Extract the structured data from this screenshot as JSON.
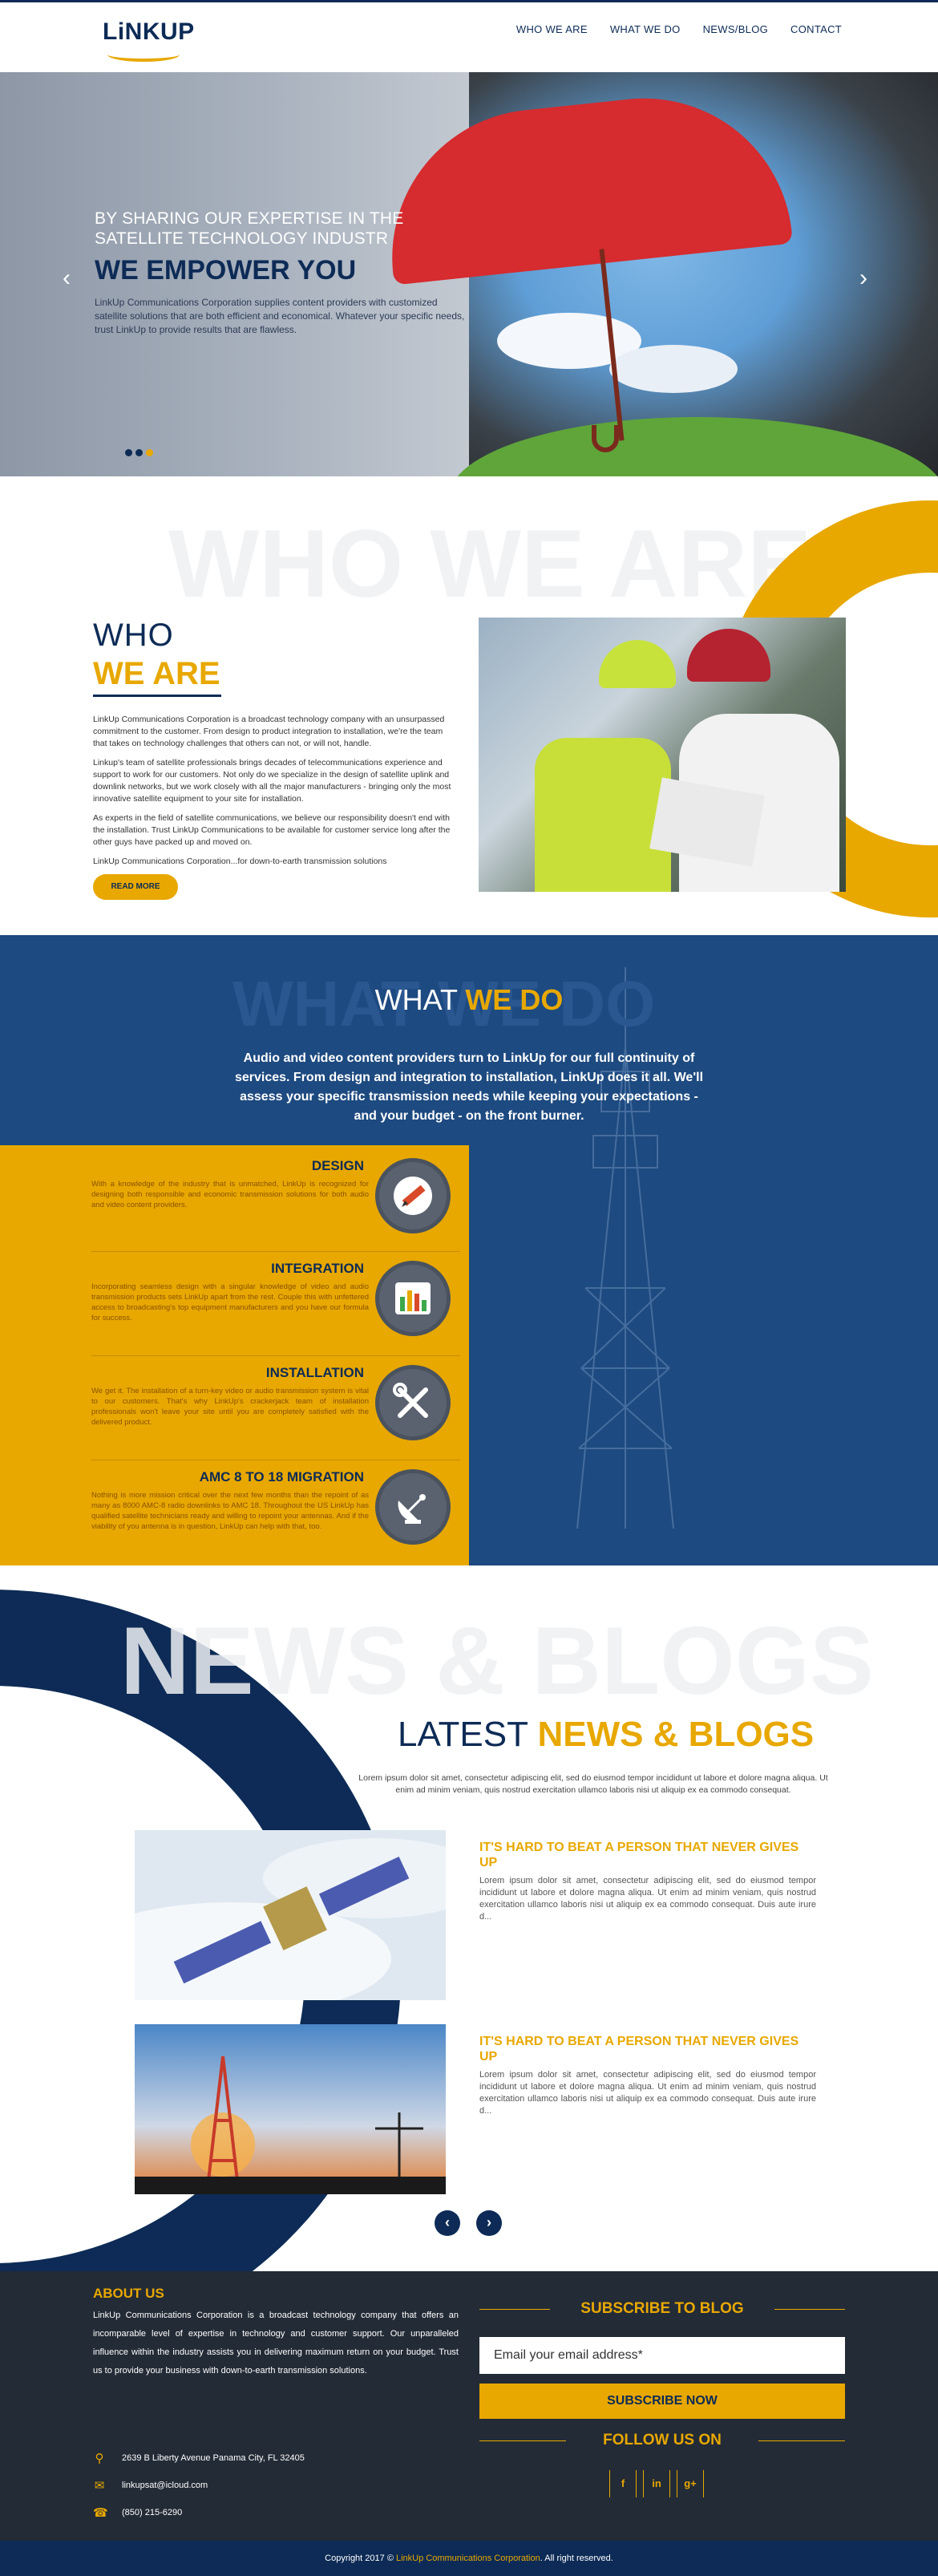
{
  "header": {
    "logo_text": "LiNKUP",
    "nav": [
      "WHO WE ARE",
      "WHAT WE DO",
      "NEWS/BLOG",
      "CONTACT"
    ]
  },
  "hero": {
    "kicker": "BY SHARING OUR EXPERTISE IN THE SATELLITE TECHNOLOGY INDUSTR",
    "title": "WE EMPOWER YOU",
    "desc": "LinkUp Communications Corporation supplies content providers with customized satellite solutions that are both efficient and economical. Whatever your specific needs, trust LinkUp to provide results that are flawless.",
    "prev_icon": "chevron-left-icon",
    "next_icon": "chevron-right-icon",
    "slides": 3,
    "active_slide": 3
  },
  "who": {
    "bg_word": "WHO WE ARE",
    "title_light": "WHO",
    "title_bold": "WE ARE",
    "paragraphs": [
      "LinkUp Communications Corporation is a broadcast technology company with an unsurpassed commitment to the customer. From design to product integration to installation, we're the team that takes on technology challenges that others can not, or will not, handle.",
      "Linkup's team of satellite professionals brings decades of telecommunications experience and support to work for our customers. Not only do we specialize in the design of satellite uplink and downlink networks, but we work closely with all the major manufacturers - bringing only the most innovative satellite equipment to your site for installation.",
      "As experts in the field of satellite communications, we believe our responsibility doesn't end with the installation. Trust LinkUp Communications to be available for customer service long after the other guys have packed up and moved on.",
      "LinkUp Communications Corporation...for down-to-earth transmission solutions"
    ],
    "read_more": "READ MORE"
  },
  "what": {
    "bg_word": "WHAT WE DO",
    "title_light": "WHAT",
    "title_bold": "WE DO",
    "intro": "Audio and video content providers turn to LinkUp for our full continuity of services. From design and integration to installation, LinkUp does it all. We'll assess your specific transmission needs while keeping your expectations - and your budget - on the front burner.",
    "services": [
      {
        "title": "DESIGN",
        "icon": "pencil-icon",
        "desc": "With a knowledge of the industry that is unmatched, LinkUp is recognized for designing both responsible and economic transmission solutions for both audio and video content providers."
      },
      {
        "title": "INTEGRATION",
        "icon": "equalizer-icon",
        "desc": "Incorporating seamless design with a singular knowledge of video and audio transmission products sets LinkUp apart from the rest. Couple this with unfettered access to broadcasting's top equipment manufacturers and you have our formula for success."
      },
      {
        "title": "INSTALLATION",
        "icon": "tools-icon",
        "desc": "We get it. The installation of a turn-key video or audio transmission system is vital to our customers. That's why LinkUp's crackerjack team of installation professionals won't leave your site until you are completely satisfied with the delivered product."
      },
      {
        "title": "AMC 8 TO 18 MIGRATION",
        "icon": "satellite-dish-icon",
        "desc": "Nothing is more mission critical over the next few months than the repoint of as many as 8000 AMC-8 radio downlinks to AMC 18. Throughout the US LinkUp has qualified satellite technicians ready and willing to repoint your antennas. And if the viability of you antenna is in question, LinkUp can help with that, too."
      }
    ]
  },
  "news": {
    "bg_word": "NEWS & BLOGS",
    "title_light": "LATEST",
    "title_bold": "NEWS & BLOGS",
    "subtitle": "Lorem ipsum dolor sit amet, consectetur adipiscing elit, sed do eiusmod tempor incididunt ut labore et dolore magna aliqua. Ut enim ad minim veniam, quis nostrud exercitation ullamco laboris nisi ut aliquip ex ea commodo consequat.",
    "posts": [
      {
        "title": "IT'S HARD TO BEAT A PERSON THAT NEVER GIVES UP",
        "text": "Lorem ipsum dolor sit amet, consectetur adipiscing elit, sed do eiusmod tempor incididunt ut labore et dolore magna aliqua. Ut enim ad minim veniam, quis nostrud exercitation ullamco laboris nisi ut aliquip ex ea commodo consequat. Duis aute irure d..."
      },
      {
        "title": "IT'S HARD TO BEAT A PERSON THAT NEVER GIVES UP",
        "text": "Lorem ipsum dolor sit amet, consectetur adipiscing elit, sed do eiusmod tempor incididunt ut labore et dolore magna aliqua. Ut enim ad minim veniam, quis nostrud exercitation ullamco laboris nisi ut aliquip ex ea commodo consequat. Duis aute irure d..."
      }
    ],
    "prev_icon": "chevron-left-icon",
    "next_icon": "chevron-right-icon"
  },
  "footer": {
    "about_title": "ABOUT US",
    "about_text": "LinkUp Communications Corporation is a broadcast technology company that offers an incomparable level of expertise in technology and customer support. Our unparalleled influence within the industry assists you in delivering maximum return on your budget. Trust us to provide your business with down-to-earth transmission solutions.",
    "address": "2639 B Liberty Avenue Panama City, FL 32405",
    "email": "linkupsat@icloud.com",
    "phone": "(850) 215-6290",
    "subscribe_title": "SUBSCRIBE TO BLOG",
    "email_placeholder": "Email your email address*",
    "subscribe_button": "SUBSCRIBE NOW",
    "follow_title": "FOLLOW US ON",
    "social": [
      {
        "icon": "facebook-icon",
        "glyph": "f"
      },
      {
        "icon": "linkedin-icon",
        "glyph": "in"
      },
      {
        "icon": "google-plus-icon",
        "glyph": "g+"
      }
    ]
  },
  "copyright": {
    "prefix": "Copyright 2017 © ",
    "company": "LinkUp Communications Corporation",
    "suffix": ". All right reserved."
  },
  "colors": {
    "navy": "#0d2b56",
    "gold": "#e8a800",
    "section_blue": "#1d4a80",
    "footer_dark": "#232b36"
  }
}
